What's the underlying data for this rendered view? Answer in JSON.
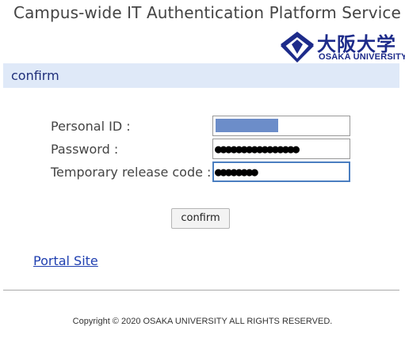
{
  "header": {
    "title": "Campus-wide IT Authentication Platform Service",
    "logo": {
      "kanji": "大阪大学",
      "english": "OSAKA UNIVERSITY",
      "color": "#1d2b8a",
      "icon": "osaka-university-emblem-icon"
    }
  },
  "section": {
    "title": "confirm",
    "background": "#dfe9f8"
  },
  "form": {
    "personal_id": {
      "label": "Personal ID :",
      "value": "",
      "redacted": true
    },
    "password": {
      "label": "Password :",
      "value": "●●●●●●●●●●●●●●●●"
    },
    "temporary_release_code": {
      "label": "Temporary release code :",
      "value": "●●●●●●●●",
      "focused": true
    }
  },
  "confirm_button": {
    "label": "confirm"
  },
  "links": {
    "portal_site": "Portal Site"
  },
  "footer": {
    "copyright": "Copyright © 2020 OSAKA UNIVERSITY ALL RIGHTS RESERVED."
  }
}
